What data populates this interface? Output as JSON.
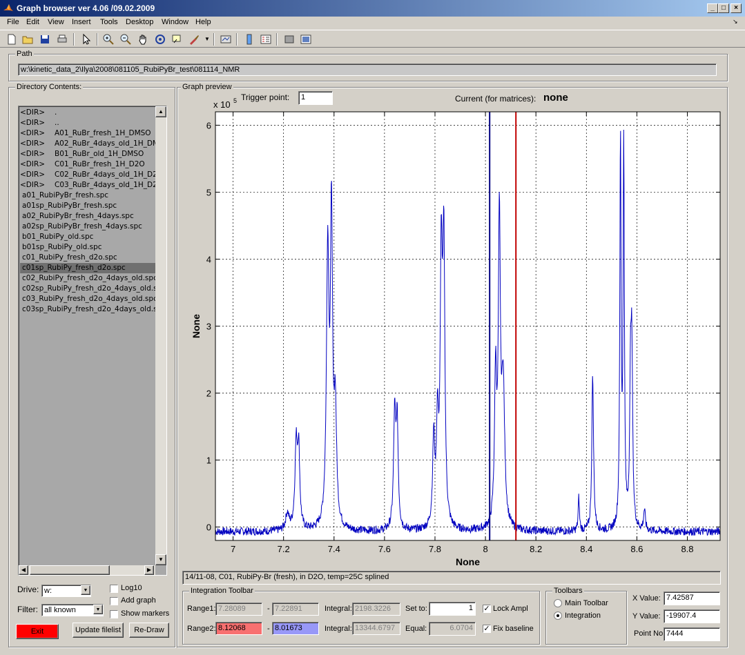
{
  "window": {
    "title": "Graph browser ver 4.06 /09.02.2009"
  },
  "menu": [
    "File",
    "Edit",
    "View",
    "Insert",
    "Tools",
    "Desktop",
    "Window",
    "Help"
  ],
  "path": {
    "label": "Path",
    "value": "w:\\kinetic_data_2\\Ilya\\2008\\081105_RubiPyBr_test\\081114_NMR"
  },
  "directory": {
    "label": "Directory Contents:",
    "items": [
      {
        "dir": "<DIR>",
        "name": "."
      },
      {
        "dir": "<DIR>",
        "name": ".."
      },
      {
        "dir": "<DIR>",
        "name": "A01_RuBr_fresh_1H_DMSO"
      },
      {
        "dir": "<DIR>",
        "name": "A02_RuBr_4days_old_1H_DMSO"
      },
      {
        "dir": "<DIR>",
        "name": "B01_RuBr_old_1H_DMSO"
      },
      {
        "dir": "<DIR>",
        "name": "C01_RuBr_fresh_1H_D2O"
      },
      {
        "dir": "<DIR>",
        "name": "C02_RuBr_4days_old_1H_D2O"
      },
      {
        "dir": "<DIR>",
        "name": "C03_RuBr_4days_old_1H_D2O"
      },
      {
        "dir": "",
        "name": "a01_RubiPyBr_fresh.spc"
      },
      {
        "dir": "",
        "name": "a01sp_RubiPyBr_fresh.spc"
      },
      {
        "dir": "",
        "name": "a02_RubiPyBr_fresh_4days.spc"
      },
      {
        "dir": "",
        "name": "a02sp_RubiPyBr_fresh_4days.spc"
      },
      {
        "dir": "",
        "name": "b01_RubiPy_old.spc"
      },
      {
        "dir": "",
        "name": "b01sp_RubiPy_old.spc"
      },
      {
        "dir": "",
        "name": "c01_RubiPy_fresh_d2o.spc"
      },
      {
        "dir": "",
        "name": "c01sp_RubiPy_fresh_d2o.spc",
        "selected": true
      },
      {
        "dir": "",
        "name": "c02_RubiPy_fresh_d2o_4days_old.spc"
      },
      {
        "dir": "",
        "name": "c02sp_RubiPy_fresh_d2o_4days_old.spc"
      },
      {
        "dir": "",
        "name": "c03_RubiPy_fresh_d2o_4days_old.spc"
      },
      {
        "dir": "",
        "name": "c03sp_RubiPy_fresh_d2o_4days_old.spc"
      }
    ]
  },
  "controls": {
    "drive_label": "Drive:",
    "drive_value": "w:",
    "filter_label": "Filter:",
    "filter_value": "all known",
    "log10": "Log10",
    "add_graph": "Add graph",
    "show_markers": "Show markers",
    "exit": "Exit",
    "update_filelist": "Update filelist",
    "redraw": "Re-Draw"
  },
  "graph": {
    "label": "Graph preview",
    "trigger_label": "Trigger point:",
    "trigger_value": "1",
    "current_label": "Current (for matrices):",
    "current_value": "none",
    "exponent_base": "x 10",
    "exponent_power": "5",
    "status": "14/11-08, C01, RubiPy-Br (fresh), in D2O, temp=25C splined"
  },
  "chart_data": {
    "type": "line",
    "xlabel": "None",
    "ylabel": "None",
    "xlim": [
      6.93,
      8.93
    ],
    "ylim": [
      -0.2,
      6.2
    ],
    "xticks": [
      "7",
      "7.2",
      "7.4",
      "7.6",
      "7.8",
      "8",
      "8.2",
      "8.4",
      "8.6",
      "8.8"
    ],
    "yticks": [
      "0",
      "1",
      "2",
      "3",
      "4",
      "5",
      "6"
    ],
    "grid": true,
    "series": [
      {
        "color": "#0000c0",
        "peaks": [
          {
            "x": 7.215,
            "h": 0.25,
            "w": 0.008
          },
          {
            "x": 7.25,
            "h": 1.25,
            "w": 0.006
          },
          {
            "x": 7.26,
            "h": 1.1,
            "w": 0.005
          },
          {
            "x": 7.375,
            "h": 4.05,
            "w": 0.006
          },
          {
            "x": 7.39,
            "h": 4.5,
            "w": 0.005
          },
          {
            "x": 7.405,
            "h": 1.7,
            "w": 0.006
          },
          {
            "x": 7.64,
            "h": 1.65,
            "w": 0.005
          },
          {
            "x": 7.65,
            "h": 1.55,
            "w": 0.005
          },
          {
            "x": 7.795,
            "h": 1.3,
            "w": 0.005
          },
          {
            "x": 7.81,
            "h": 1.45,
            "w": 0.005
          },
          {
            "x": 7.825,
            "h": 3.8,
            "w": 0.005
          },
          {
            "x": 7.835,
            "h": 4.0,
            "w": 0.005
          },
          {
            "x": 8.04,
            "h": 2.2,
            "w": 0.005
          },
          {
            "x": 8.055,
            "h": 4.45,
            "w": 0.005
          },
          {
            "x": 8.07,
            "h": 2.1,
            "w": 0.007
          },
          {
            "x": 8.37,
            "h": 0.5,
            "w": 0.003
          },
          {
            "x": 8.425,
            "h": 2.35,
            "w": 0.004
          },
          {
            "x": 8.535,
            "h": 5.75,
            "w": 0.003
          },
          {
            "x": 8.548,
            "h": 5.65,
            "w": 0.003
          },
          {
            "x": 8.575,
            "h": 2.0,
            "w": 0.004
          },
          {
            "x": 8.58,
            "h": 2.35,
            "w": 0.004
          },
          {
            "x": 8.63,
            "h": 0.3,
            "w": 0.004
          }
        ],
        "baseline": -0.07
      }
    ],
    "markers": [
      {
        "x": 8.0167,
        "color": "#000080"
      },
      {
        "x": 8.1207,
        "color": "#c00000"
      }
    ]
  },
  "integration": {
    "label": "Integration Toolbar",
    "range1_label": "Range1:",
    "range1_from": "7.28089",
    "range1_to": "7.22891",
    "range2_label": "Range2:",
    "range2_from": "8.12068",
    "range2_to": "8.01673",
    "dash": "-",
    "integral_label": "Integral:",
    "integral1": "2198.3226",
    "integral2": "13344.6797",
    "setto_label": "Set to:",
    "setto_value": "1",
    "equal_label": "Equal:",
    "equal_value": "6.0704",
    "lock_ampl": "Lock Ampl",
    "fix_baseline": "Fix baseline",
    "range2_from_color": "#f87070",
    "range2_to_color": "#9898f8"
  },
  "toolbars": {
    "label": "Toolbars",
    "main": "Main Toolbar",
    "integration": "Integration"
  },
  "values": {
    "x_label": "X Value:",
    "x_value": "7.42587",
    "y_label": "Y Value:",
    "y_value": "-19907.4",
    "point_label": "Point No:",
    "point_value": "7444"
  }
}
